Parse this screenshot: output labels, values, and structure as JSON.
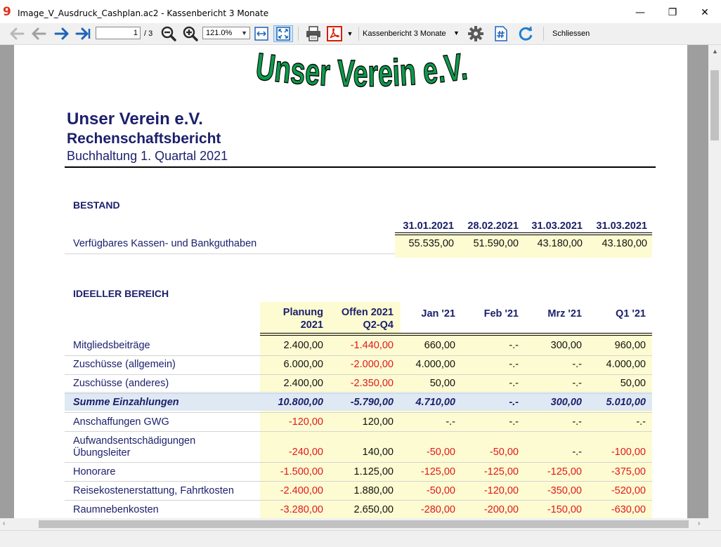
{
  "window": {
    "title": "Image_V_Ausdruck_Cashplan.ac2 - Kassenbericht 3 Monate",
    "minimize": "—",
    "maximize": "❐",
    "close": "✕"
  },
  "toolbar": {
    "page_current": "1",
    "page_total": "/ 3",
    "zoom": "121.0%",
    "report": "Kassenbericht 3 Monate",
    "close_label": "Schliessen"
  },
  "report": {
    "logo_text": "Unser Verein e.V.",
    "org": "Unser Verein e.V.",
    "subtitle": "Rechenschaftsbericht",
    "period": "Buchhaltung 1. Quartal 2021",
    "bestand": {
      "title": "BESTAND",
      "columns": [
        "31.01.2021",
        "28.02.2021",
        "31.03.2021",
        "31.03.2021"
      ],
      "row": {
        "label": "Verfügbares Kassen- und Bankguthaben",
        "values": [
          "55.535,00",
          "51.590,00",
          "43.180,00",
          "43.180,00"
        ]
      }
    },
    "ideeller": {
      "title": "IDEELLER BEREICH",
      "columns": [
        {
          "l1": "Planung",
          "l2": "2021"
        },
        {
          "l1": "Offen 2021",
          "l2": "Q2-Q4"
        },
        {
          "l1": "Jan '21",
          "l2": ""
        },
        {
          "l1": "Feb '21",
          "l2": ""
        },
        {
          "l1": "Mrz '21",
          "l2": ""
        },
        {
          "l1": "Q1 '21",
          "l2": ""
        }
      ],
      "rows": [
        {
          "label": "Mitgliedsbeiträge",
          "values": [
            "2.400,00",
            "-1.440,00",
            "660,00",
            "-.-",
            "300,00",
            "960,00"
          ]
        },
        {
          "label": "Zuschüsse (allgemein)",
          "values": [
            "6.000,00",
            "-2.000,00",
            "4.000,00",
            "-.-",
            "-.-",
            "4.000,00"
          ]
        },
        {
          "label": "Zuschüsse (anderes)",
          "values": [
            "2.400,00",
            "-2.350,00",
            "50,00",
            "-.-",
            "-.-",
            "50,00"
          ]
        },
        {
          "label": "Summe Einzahlungen",
          "values": [
            "10.800,00",
            "-5.790,00",
            "4.710,00",
            "-.-",
            "300,00",
            "5.010,00"
          ]
        },
        {
          "label": "Anschaffungen GWG",
          "values": [
            "-120,00",
            "120,00",
            "-.-",
            "-.-",
            "-.-",
            "-.-"
          ]
        },
        {
          "label": "Aufwandsentschädigungen",
          "label2": "Übungsleiter",
          "values": [
            "-240,00",
            "140,00",
            "-50,00",
            "-50,00",
            "-.-",
            "-100,00"
          ]
        },
        {
          "label": "Honorare",
          "values": [
            "-1.500,00",
            "1.125,00",
            "-125,00",
            "-125,00",
            "-125,00",
            "-375,00"
          ]
        },
        {
          "label": "Reisekostenerstattung, Fahrtkosten",
          "values": [
            "-2.400,00",
            "1.880,00",
            "-50,00",
            "-120,00",
            "-350,00",
            "-520,00"
          ]
        },
        {
          "label": "Raumnebenkosten",
          "values": [
            "-3.280,00",
            "2.650,00",
            "-280,00",
            "-200,00",
            "-150,00",
            "-630,00"
          ]
        }
      ]
    }
  },
  "colors": {
    "heading": "#1b1f6b",
    "negative": "#e0181f",
    "highlight": "#fdfbd1",
    "sum_row": "#dfe9f3",
    "logo": "#0e9a4a"
  },
  "icons": [
    "back-disabled-icon",
    "back-icon",
    "forward-icon",
    "last-page-icon",
    "zoom-out-icon",
    "zoom-in-icon",
    "fit-width-icon",
    "fit-page-icon",
    "print-icon",
    "pdf-icon",
    "gear-icon",
    "numbering-icon",
    "refresh-icon"
  ]
}
